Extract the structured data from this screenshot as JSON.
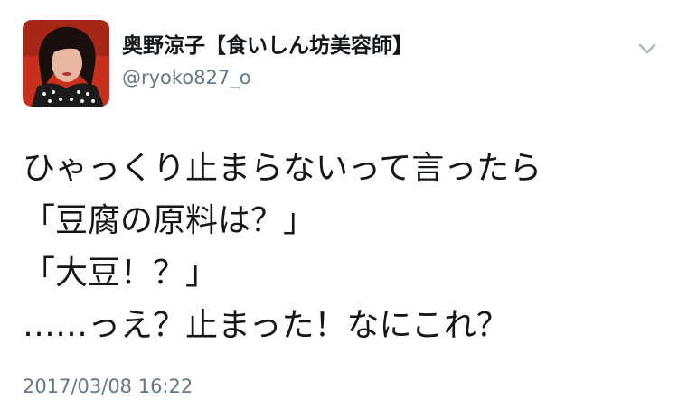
{
  "tweet": {
    "author": {
      "display_name": "奥野涼子【食いしん坊美容師】",
      "handle": "@ryoko827_o"
    },
    "menu_icon": "chevron-down-icon",
    "body_lines": [
      "ひゃっくり止まらないって言ったら",
      "「豆腐の原料は？」",
      "「大豆！？」",
      "……っえ？止まった！なにこれ？"
    ],
    "timestamp": "2017/03/08 16:22"
  },
  "colors": {
    "text": "#14171a",
    "secondary": "#657786",
    "caret": "#aab8c2",
    "avatar_bg": "#c8301e"
  }
}
